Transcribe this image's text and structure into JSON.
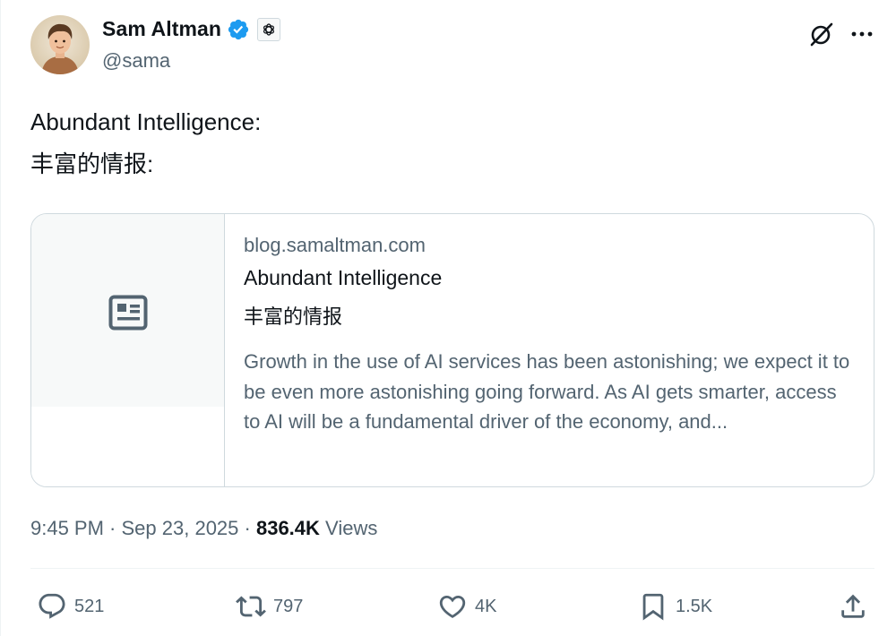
{
  "author": {
    "display_name": "Sam Altman",
    "handle": "@sama",
    "verified_icon": "verified-badge-icon",
    "affiliation_icon": "openai-logo-icon",
    "accent_color": "#1d9bf0"
  },
  "header_actions": {
    "grok_icon": "grok-icon",
    "more_icon": "more-icon"
  },
  "tweet": {
    "line1": "Abundant Intelligence:",
    "line2": "丰富的情报:"
  },
  "card": {
    "thumbnail_icon": "article-icon",
    "domain": "blog.samaltman.com",
    "title": "Abundant Intelligence",
    "subtitle": "丰富的情报",
    "description": "Growth in the use of AI services has been astonishing; we expect it to be even more astonishing going forward. As AI gets smarter, access to AI will be a fundamental driver of the economy, and..."
  },
  "meta": {
    "time": "9:45 PM",
    "separator": " · ",
    "date": "Sep 23, 2025",
    "views_count": "836.4K",
    "views_label": "Views"
  },
  "actions": {
    "replies": "521",
    "retweets": "797",
    "likes": "4K",
    "bookmarks": "1.5K",
    "share_icon": "share-icon"
  },
  "colors": {
    "text_primary": "#0f1419",
    "text_secondary": "#536471",
    "border": "#cfd9de"
  }
}
